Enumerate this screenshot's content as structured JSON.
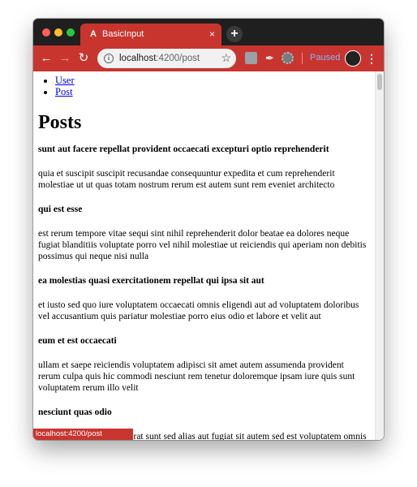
{
  "browser": {
    "tab_title": "BasicInput",
    "tab_favicon": "A",
    "tab_close": "×",
    "new_tab": "+",
    "url_host": "localhost",
    "url_path": ":4200/post",
    "paused_label": "Paused",
    "status_url": "localhost:4200/post",
    "accent_color": "#c8352f"
  },
  "nav": {
    "items": [
      {
        "label": "User"
      },
      {
        "label": "Post"
      }
    ]
  },
  "page": {
    "title": "Posts"
  },
  "posts": [
    {
      "title": "sunt aut facere repellat provident occaecati excepturi optio reprehenderit",
      "body": "quia et suscipit suscipit recusandae consequuntur expedita et cum reprehenderit molestiae ut ut quas totam nostrum rerum est autem sunt rem eveniet architecto"
    },
    {
      "title": "qui est esse",
      "body": "est rerum tempore vitae sequi sint nihil reprehenderit dolor beatae ea dolores neque fugiat blanditiis voluptate porro vel nihil molestiae ut reiciendis qui aperiam non debitis possimus qui neque nisi nulla"
    },
    {
      "title": "ea molestias quasi exercitationem repellat qui ipsa sit aut",
      "body": "et iusto sed quo iure voluptatem occaecati omnis eligendi aut ad voluptatem doloribus vel accusantium quis pariatur molestiae porro eius odio et labore et velit aut"
    },
    {
      "title": "eum et est occaecati",
      "body": "ullam et saepe reiciendis voluptatem adipisci sit amet autem assumenda provident rerum culpa quis hic commodi nesciunt rem tenetur doloremque ipsam iure quis sunt voluptatem rerum illo velit"
    },
    {
      "title": "nesciunt quas odio",
      "body": "repudiandae veniam quaerat sunt sed alias aut fugiat sit autem sed est voluptatem omnis possimus esse voluptatibus quis est aut tenetur dolor neque"
    }
  ]
}
